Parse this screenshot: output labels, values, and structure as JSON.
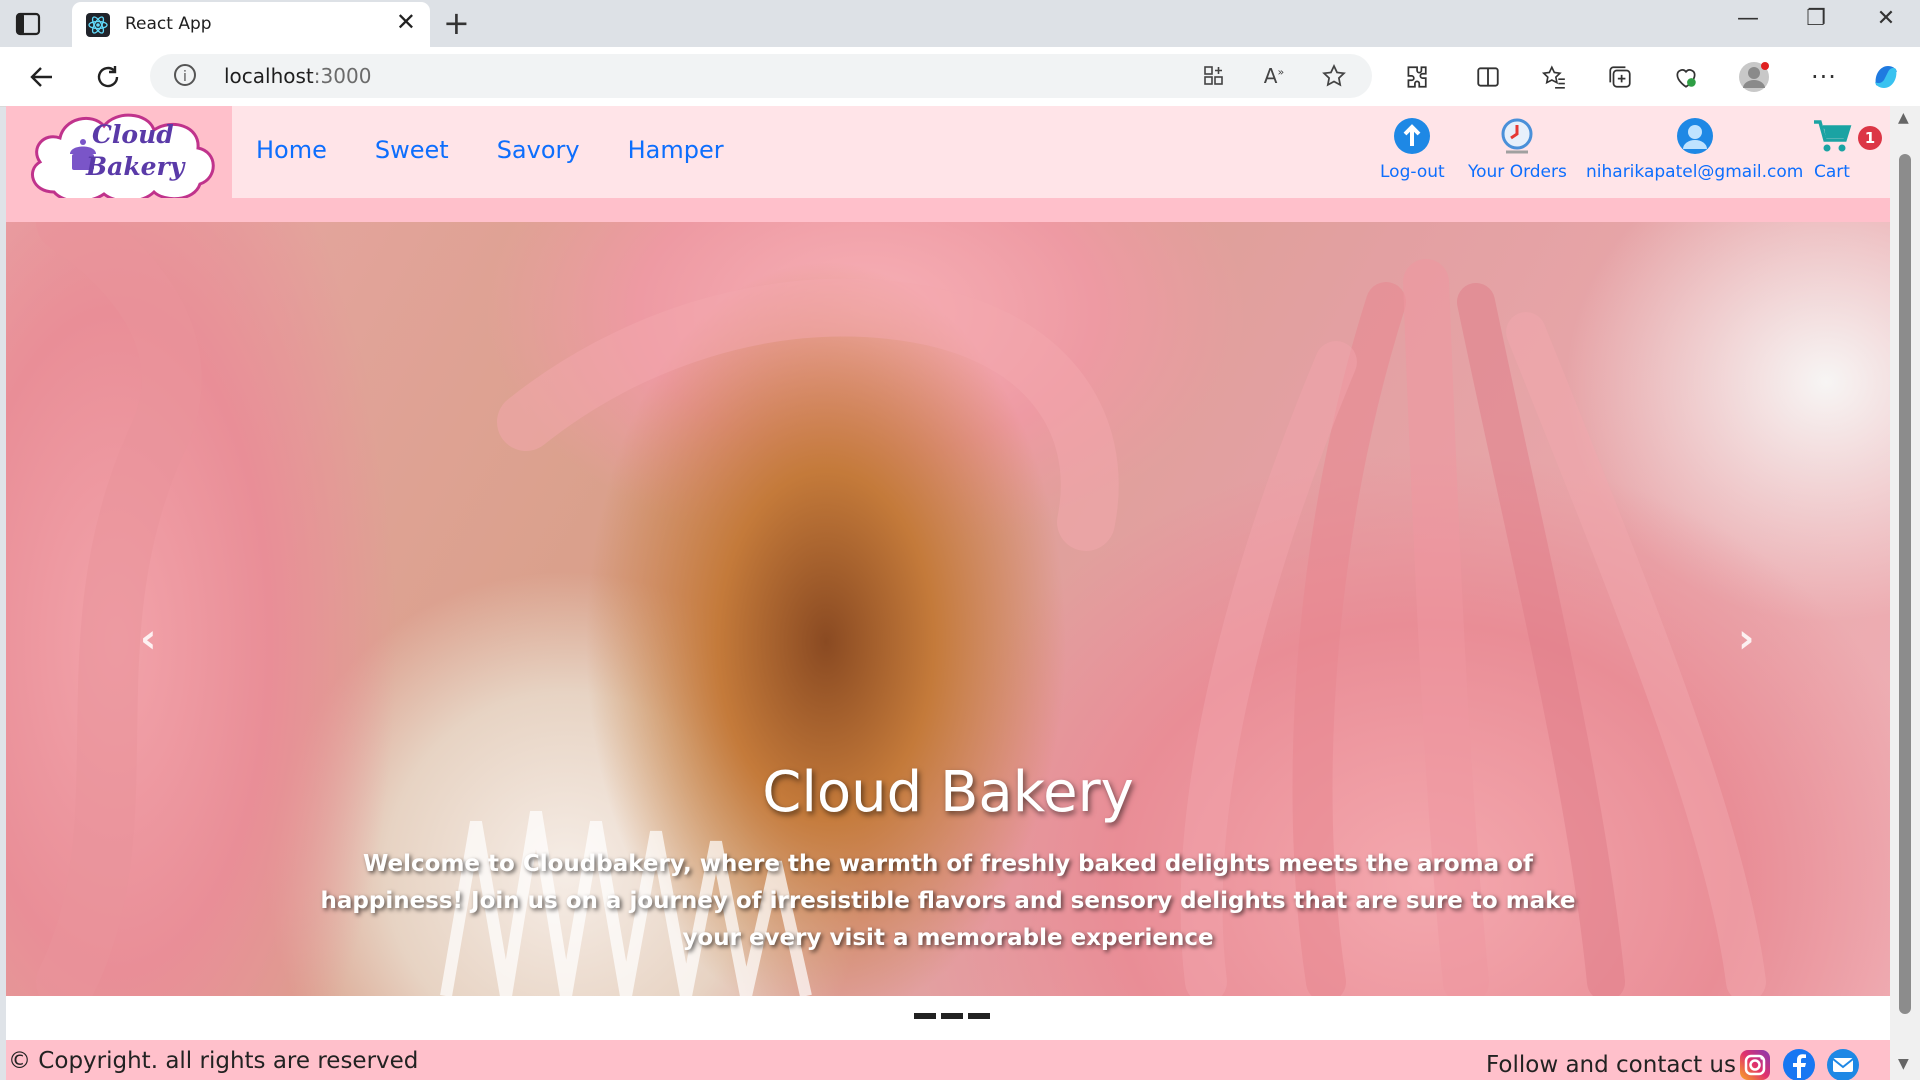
{
  "browser": {
    "tab_title": "React App",
    "url_host": "localhost",
    "url_port": ":3000"
  },
  "nav": {
    "logo_line1": "Cloud",
    "logo_line2": "Bakery",
    "links": [
      "Home",
      "Sweet",
      "Savory",
      "Hamper"
    ],
    "logout_label": "Log-out",
    "orders_label": "Your Orders",
    "user_email": "niharikapatel@gmail.com",
    "cart_label": "Cart",
    "cart_count": "1"
  },
  "hero": {
    "title": "Cloud Bakery",
    "text": "Welcome to Cloudbakery, where the warmth of freshly baked delights meets the aroma of happiness! Join us on a journey of irresistible flavors and sensory delights that are sure to make your every visit a memorable experience",
    "prev_arrow": "‹",
    "next_arrow": "›"
  },
  "footer": {
    "copyright": "© Copyright. all rights are reserved",
    "follow": "Follow and contact us -"
  },
  "colors": {
    "nav_bg": "#ffe4e8",
    "accent_pink": "#ffc0cb",
    "link_blue": "#0d6efd",
    "badge_red": "#dc3545"
  }
}
